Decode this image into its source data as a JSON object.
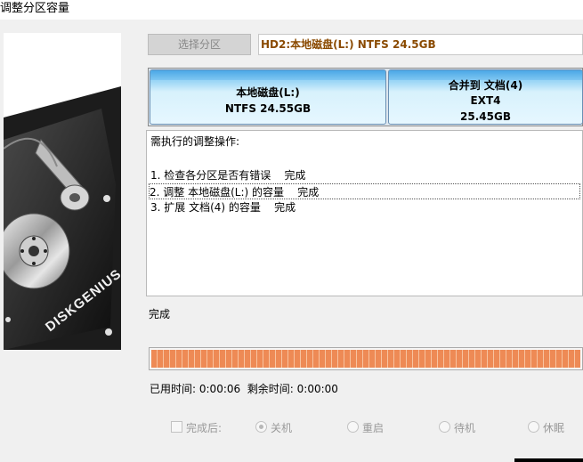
{
  "window": {
    "title": "调整分区容量"
  },
  "toolbar": {
    "select_partition_label": "选择分区",
    "disk_info": "HD2:本地磁盘(L:) NTFS 24.5GB"
  },
  "partitions": [
    {
      "name": "本地磁盘(L:)",
      "fs": "NTFS 24.55GB"
    },
    {
      "name": "合并到 文档(4)",
      "fs": "EXT4",
      "size": "25.45GB"
    }
  ],
  "operations": {
    "header": "需执行的调整操作:",
    "items": [
      "1. 检查各分区是否有错误    完成",
      "2. 调整 本地磁盘(L:) 的容量    完成",
      "3. 扩展 文档(4) 的容量    完成"
    ]
  },
  "status": {
    "text": "完成"
  },
  "progress": {
    "percent": 100,
    "color": "#ee8a55"
  },
  "times": {
    "elapsed_label": "已用时间:",
    "elapsed": "0:00:06",
    "remaining_label": "剩余时间:",
    "remaining": "0:00:00"
  },
  "after_completion": {
    "checkbox_label": "完成后:",
    "options": [
      "关机",
      "重启",
      "待机",
      "休眠"
    ],
    "selected": "关机"
  },
  "art": {
    "brand_text": "DISKGENIUS"
  }
}
